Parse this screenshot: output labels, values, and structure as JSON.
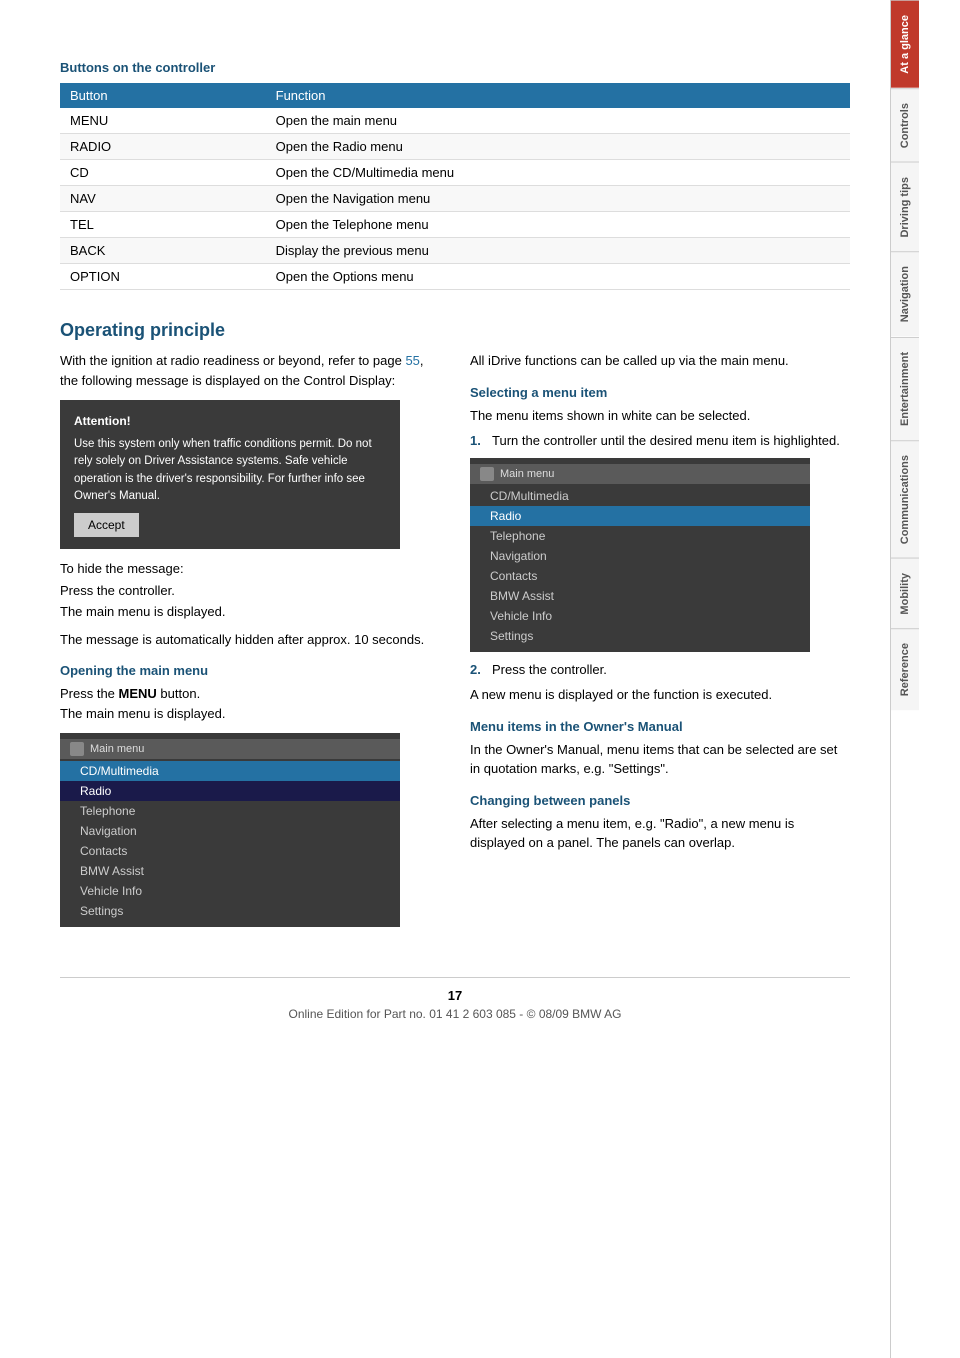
{
  "sidebar": {
    "tabs": [
      {
        "label": "At a glance",
        "active": true
      },
      {
        "label": "Controls",
        "active": false
      },
      {
        "label": "Driving tips",
        "active": false
      },
      {
        "label": "Navigation",
        "active": false
      },
      {
        "label": "Entertainment",
        "active": false
      },
      {
        "label": "Communications",
        "active": false
      },
      {
        "label": "Mobility",
        "active": false
      },
      {
        "label": "Reference",
        "active": false
      }
    ]
  },
  "buttons_section": {
    "title": "Buttons on the controller",
    "table": {
      "headers": [
        "Button",
        "Function"
      ],
      "rows": [
        {
          "button": "MENU",
          "function": "Open the main menu"
        },
        {
          "button": "RADIO",
          "function": "Open the Radio menu"
        },
        {
          "button": "CD",
          "function": "Open the CD/Multimedia menu"
        },
        {
          "button": "NAV",
          "function": "Open the Navigation menu"
        },
        {
          "button": "TEL",
          "function": "Open the Telephone menu"
        },
        {
          "button": "BACK",
          "function": "Display the previous menu"
        },
        {
          "button": "OPTION",
          "function": "Open the Options menu"
        }
      ]
    }
  },
  "operating_principle": {
    "title": "Operating principle",
    "intro_text": "With the ignition at radio readiness or beyond, refer to page 55, the following message is displayed on the Control Display:",
    "page_link": "55",
    "attention_box": {
      "title": "Attention!",
      "text": "Use this system only when traffic conditions permit. Do not rely solely on Driver Assistance systems. Safe vehicle operation is the driver's responsibility. For further info see Owner's Manual.",
      "button": "Accept"
    },
    "hide_message": {
      "line1": "To hide the message:",
      "line2": "Press the controller.",
      "line3": "The main menu is displayed."
    },
    "auto_hide": "The message is automatically hidden after approx. 10 seconds.",
    "opening_main_menu": {
      "subtitle": "Opening the main menu",
      "text_pre": "Press the ",
      "bold_word": "MENU",
      "text_post": " button.",
      "line2": "The main menu is displayed."
    },
    "main_menu_screenshot": {
      "title": "Main menu",
      "items": [
        {
          "label": "CD/Multimedia",
          "state": "highlighted"
        },
        {
          "label": "Radio",
          "state": "selected"
        },
        {
          "label": "Telephone",
          "state": "normal"
        },
        {
          "label": "Navigation",
          "state": "normal"
        },
        {
          "label": "Contacts",
          "state": "normal"
        },
        {
          "label": "BMW Assist",
          "state": "normal"
        },
        {
          "label": "Vehicle Info",
          "state": "normal"
        },
        {
          "label": "Settings",
          "state": "normal"
        }
      ]
    },
    "right_col": {
      "intro": "All iDrive functions can be called up via the main menu.",
      "selecting_menu_item": {
        "subtitle": "Selecting a menu item",
        "text": "The menu items shown in white can be selected.",
        "step1": "Turn the controller until the desired menu item is highlighted.",
        "menu_screenshot": {
          "title": "Main menu",
          "items": [
            {
              "label": "CD/Multimedia",
              "state": "normal"
            },
            {
              "label": "Radio",
              "state": "highlighted"
            },
            {
              "label": "Telephone",
              "state": "normal"
            },
            {
              "label": "Navigation",
              "state": "normal"
            },
            {
              "label": "Contacts",
              "state": "normal"
            },
            {
              "label": "BMW Assist",
              "state": "normal"
            },
            {
              "label": "Vehicle Info",
              "state": "normal"
            },
            {
              "label": "Settings",
              "state": "normal"
            }
          ]
        },
        "step2": "Press the controller.",
        "result": "A new menu is displayed or the function is executed."
      },
      "menu_items_owners_manual": {
        "subtitle": "Menu items in the Owner's Manual",
        "text": "In the Owner's Manual, menu items that can be selected are set in quotation marks, e.g. \"Settings\"."
      },
      "changing_panels": {
        "subtitle": "Changing between panels",
        "text": "After selecting a menu item, e.g. \"Radio\", a new menu is displayed on a panel. The panels can overlap."
      }
    }
  },
  "footer": {
    "page_number": "17",
    "text": "Online Edition for Part no. 01 41 2 603 085 - © 08/09 BMW AG"
  }
}
